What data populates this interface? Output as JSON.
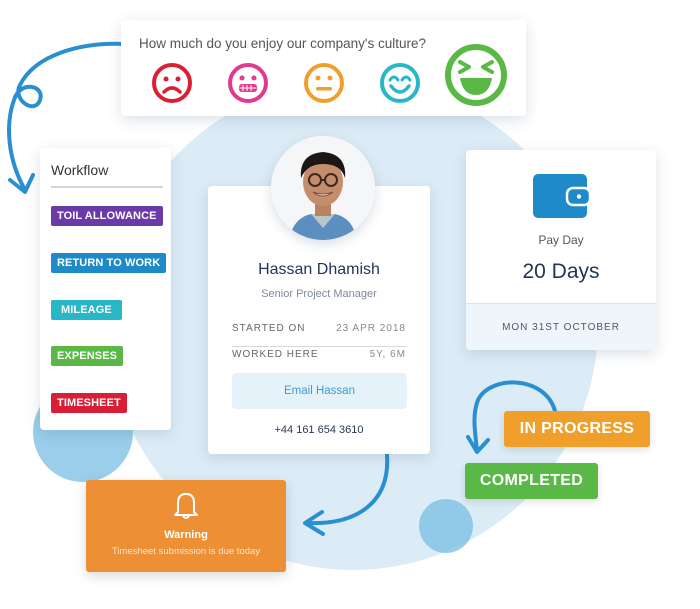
{
  "survey": {
    "question": "How much do you enjoy our company's culture?",
    "options": [
      {
        "icon": "sad-face-icon",
        "color": "#d91f36"
      },
      {
        "icon": "grimace-face-icon",
        "color": "#e0398f"
      },
      {
        "icon": "neutral-face-icon",
        "color": "#f0a02a"
      },
      {
        "icon": "smile-face-icon",
        "color": "#27b7c6"
      },
      {
        "icon": "laughing-face-icon",
        "color": "#5ab846",
        "selected": true
      }
    ]
  },
  "workflow": {
    "title": "Workflow",
    "items": [
      {
        "label": "TOIL ALLOWANCE",
        "color": "#6a3aa8"
      },
      {
        "label": "RETURN TO WORK",
        "color": "#1f8ac8"
      },
      {
        "label": "MILEAGE",
        "color": "#27b7c6"
      },
      {
        "label": "EXPENSES",
        "color": "#5ab846"
      },
      {
        "label": "TIMESHEET",
        "color": "#d91f36"
      }
    ]
  },
  "profile": {
    "name": "Hassan Dhamish",
    "role": "Senior Project Manager",
    "started_label": "STARTED ON",
    "started_value": "23 APR 2018",
    "worked_label": "WORKED HERE",
    "worked_value": "5Y, 6M",
    "email_button": "Email Hassan",
    "phone": "+44 161 654 3610"
  },
  "payday": {
    "icon": "wallet-icon",
    "label": "Pay Day",
    "value": "20 Days",
    "date": "MON 31ST OCTOBER"
  },
  "warning": {
    "icon": "bell-icon",
    "title": "Warning",
    "message": "Timesheet submission is due today"
  },
  "status": {
    "in_progress": "IN PROGRESS",
    "completed": "COMPLETED"
  },
  "colors": {
    "accent_blue": "#2a8fd0",
    "warning_orange": "#ec8f35",
    "progress_orange": "#f0a02a",
    "completed_green": "#5ab846"
  }
}
